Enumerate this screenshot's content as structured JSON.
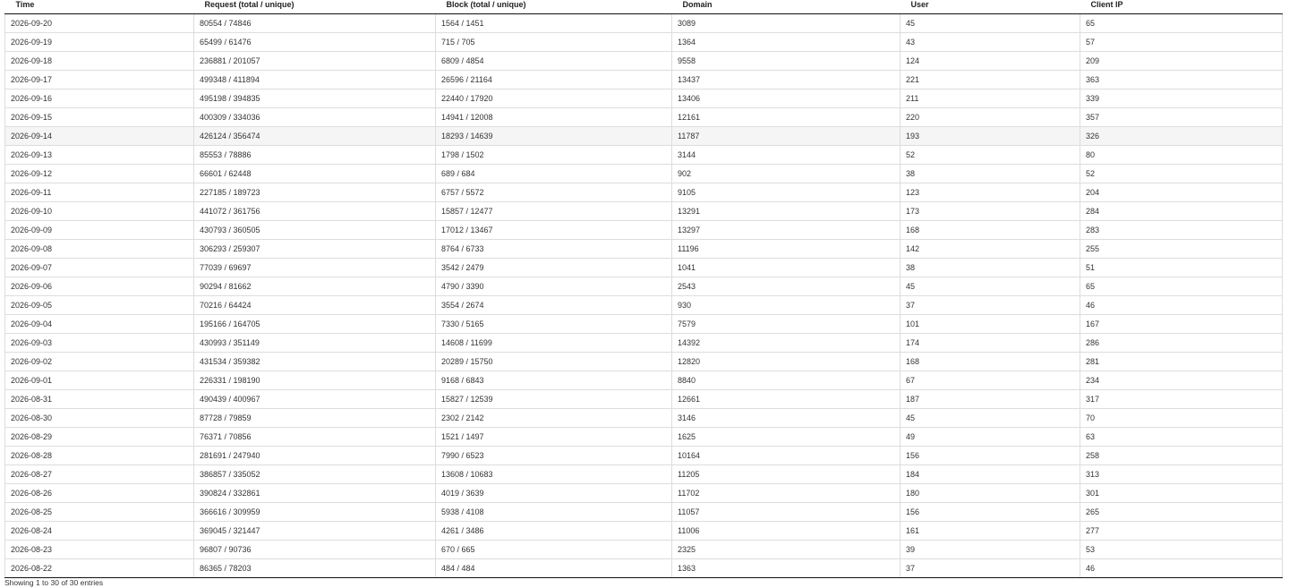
{
  "columns": [
    "Time",
    "Request (total / unique)",
    "Block (total / unique)",
    "Domain",
    "User",
    "Client IP"
  ],
  "rows": [
    [
      "2026-09-20",
      "80554 / 74846",
      "1564 / 1451",
      "3089",
      "45",
      "65"
    ],
    [
      "2026-09-19",
      "65499 / 61476",
      "715 / 705",
      "1364",
      "43",
      "57"
    ],
    [
      "2026-09-18",
      "236881 / 201057",
      "6809 / 4854",
      "9558",
      "124",
      "209"
    ],
    [
      "2026-09-17",
      "499348 / 411894",
      "26596 / 21164",
      "13437",
      "221",
      "363"
    ],
    [
      "2026-09-16",
      "495198 / 394835",
      "22440 / 17920",
      "13406",
      "211",
      "339"
    ],
    [
      "2026-09-15",
      "400309 / 334036",
      "14941 / 12008",
      "12161",
      "220",
      "357"
    ],
    [
      "2026-09-14",
      "426124 / 356474",
      "18293 / 14639",
      "11787",
      "193",
      "326"
    ],
    [
      "2026-09-13",
      "85553 / 78886",
      "1798 / 1502",
      "3144",
      "52",
      "80"
    ],
    [
      "2026-09-12",
      "66601 / 62448",
      "689 / 684",
      "902",
      "38",
      "52"
    ],
    [
      "2026-09-11",
      "227185 / 189723",
      "6757 / 5572",
      "9105",
      "123",
      "204"
    ],
    [
      "2026-09-10",
      "441072 / 361756",
      "15857 / 12477",
      "13291",
      "173",
      "284"
    ],
    [
      "2026-09-09",
      "430793 / 360505",
      "17012 / 13467",
      "13297",
      "168",
      "283"
    ],
    [
      "2026-09-08",
      "306293 / 259307",
      "8764 / 6733",
      "11196",
      "142",
      "255"
    ],
    [
      "2026-09-07",
      "77039 / 69697",
      "3542 / 2479",
      "1041",
      "38",
      "51"
    ],
    [
      "2026-09-06",
      "90294 / 81662",
      "4790 / 3390",
      "2543",
      "45",
      "65"
    ],
    [
      "2026-09-05",
      "70216 / 64424",
      "3554 / 2674",
      "930",
      "37",
      "46"
    ],
    [
      "2026-09-04",
      "195166 / 164705",
      "7330 / 5165",
      "7579",
      "101",
      "167"
    ],
    [
      "2026-09-03",
      "430993 / 351149",
      "14608 / 11699",
      "14392",
      "174",
      "286"
    ],
    [
      "2026-09-02",
      "431534 / 359382",
      "20289 / 15750",
      "12820",
      "168",
      "281"
    ],
    [
      "2026-09-01",
      "226331 / 198190",
      "9168 / 6843",
      "8840",
      "67",
      "234"
    ],
    [
      "2026-08-31",
      "490439 / 400967",
      "15827 / 12539",
      "12661",
      "187",
      "317"
    ],
    [
      "2026-08-30",
      "87728 / 79859",
      "2302 / 2142",
      "3146",
      "45",
      "70"
    ],
    [
      "2026-08-29",
      "76371 / 70856",
      "1521 / 1497",
      "1625",
      "49",
      "63"
    ],
    [
      "2026-08-28",
      "281691 / 247940",
      "7990 / 6523",
      "10164",
      "156",
      "258"
    ],
    [
      "2026-08-27",
      "386857 / 335052",
      "13608 / 10683",
      "11205",
      "184",
      "313"
    ],
    [
      "2026-08-26",
      "390824 / 332861",
      "4019 / 3639",
      "11702",
      "180",
      "301"
    ],
    [
      "2026-08-25",
      "366616 / 309959",
      "5938 / 4108",
      "11057",
      "156",
      "265"
    ],
    [
      "2026-08-24",
      "369045 / 321447",
      "4261 / 3486",
      "11006",
      "161",
      "277"
    ],
    [
      "2026-08-23",
      "96807 / 90736",
      "670 / 665",
      "2325",
      "39",
      "53"
    ],
    [
      "2026-08-22",
      "86365 / 78203",
      "484 / 484",
      "1363",
      "37",
      "46"
    ]
  ],
  "highlighted_row": 6,
  "footer": {
    "info": "Showing 1 to 30 of 30 entries"
  }
}
